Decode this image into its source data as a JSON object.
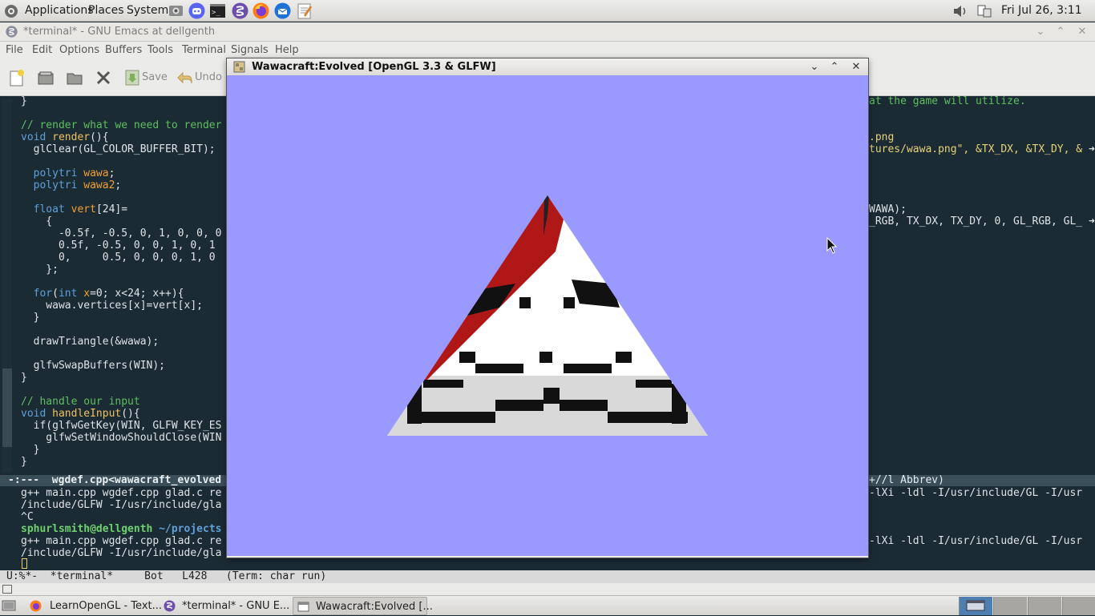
{
  "top_panel": {
    "menus": [
      "Applications",
      "Places",
      "System"
    ],
    "launchers": [
      "screenshot-icon",
      "discord-icon",
      "terminal-icon",
      "emacs-icon",
      "firefox-icon",
      "thunderbird-icon",
      "text-editor-icon"
    ],
    "clock": "Fri Jul 26,  3:11 PM"
  },
  "emacs": {
    "title": "*terminal* - GNU Emacs at dellgenth",
    "menu": [
      "File",
      "Edit",
      "Options",
      "Buffers",
      "Tools",
      "Terminal",
      "Signals",
      "Help"
    ],
    "toolbar": {
      "save_label": "Save",
      "undo_label": "Undo"
    },
    "code_left": [
      "}",
      "",
      "// render what we need to render",
      "void render(){",
      "  glClear(GL_COLOR_BUFFER_BIT);",
      "",
      "  polytri wawa;",
      "  polytri wawa2;",
      "",
      "  float vert[24]=",
      "    {",
      "      -0.5f, -0.5, 0, 1, 0, 0, 0",
      "      0.5f, -0.5, 0, 0, 1, 0, 1",
      "      0,     0.5, 0, 0, 0, 1, 0",
      "    };",
      "",
      "  for(int x=0; x<24; x++){",
      "    wawa.vertices[x]=vert[x];",
      "  }",
      "",
      "  drawTriangle(&wawa);",
      "",
      "  glfwSwapBuffers(WIN);",
      "}",
      "",
      "// handle our input",
      "void handleInput(){",
      "  if(glfwGetKey(WIN, GLFW_KEY_ES",
      "    glfwSetWindowShouldClose(WIN",
      "  }",
      "}"
    ],
    "code_right": {
      "comment": "at the game will utilize.",
      "png": ".png",
      "load": "tures/wawa.png\", &TX_DX, &TX_DY, &",
      "wawa": "WAWA);",
      "rgb": "_RGB, TX_DX, TX_DY, 0, GL_RGB, GL_"
    },
    "modeline_top_left": "-:---  wgdef.cpp<wawacraft_evolved",
    "modeline_top_right": "+//l Abbrev)",
    "terminal_lines": {
      "l1_left": "g++ main.cpp wgdef.cpp glad.c re",
      "l1_right": "-lXi -ldl -I/usr/include/GL -I/usr",
      "l2_left": "/include/GLFW -I/usr/include/gla",
      "l3": "^C",
      "prompt_user": "sphurlsmith@dellgenth",
      "prompt_path": " ~/projects",
      "l5_left": "g++ main.cpp wgdef.cpp glad.c re",
      "l5_right": "-lXi -ldl -I/usr/include/GL -I/usr",
      "l6_left": "/include/GLFW -I/usr/include/gla"
    },
    "modeline_bottom": "U:%*-  *terminal*     Bot   L428   (Term: char run)"
  },
  "game_window": {
    "title": "Wawacraft:Evolved [OpenGL 3.3 & GLFW]",
    "background": "#9999ff"
  },
  "taskbar": {
    "tasks": [
      "LearnOpenGL - Text...",
      "*terminal* - GNU E...",
      "Wawacraft:Evolved [..."
    ]
  }
}
